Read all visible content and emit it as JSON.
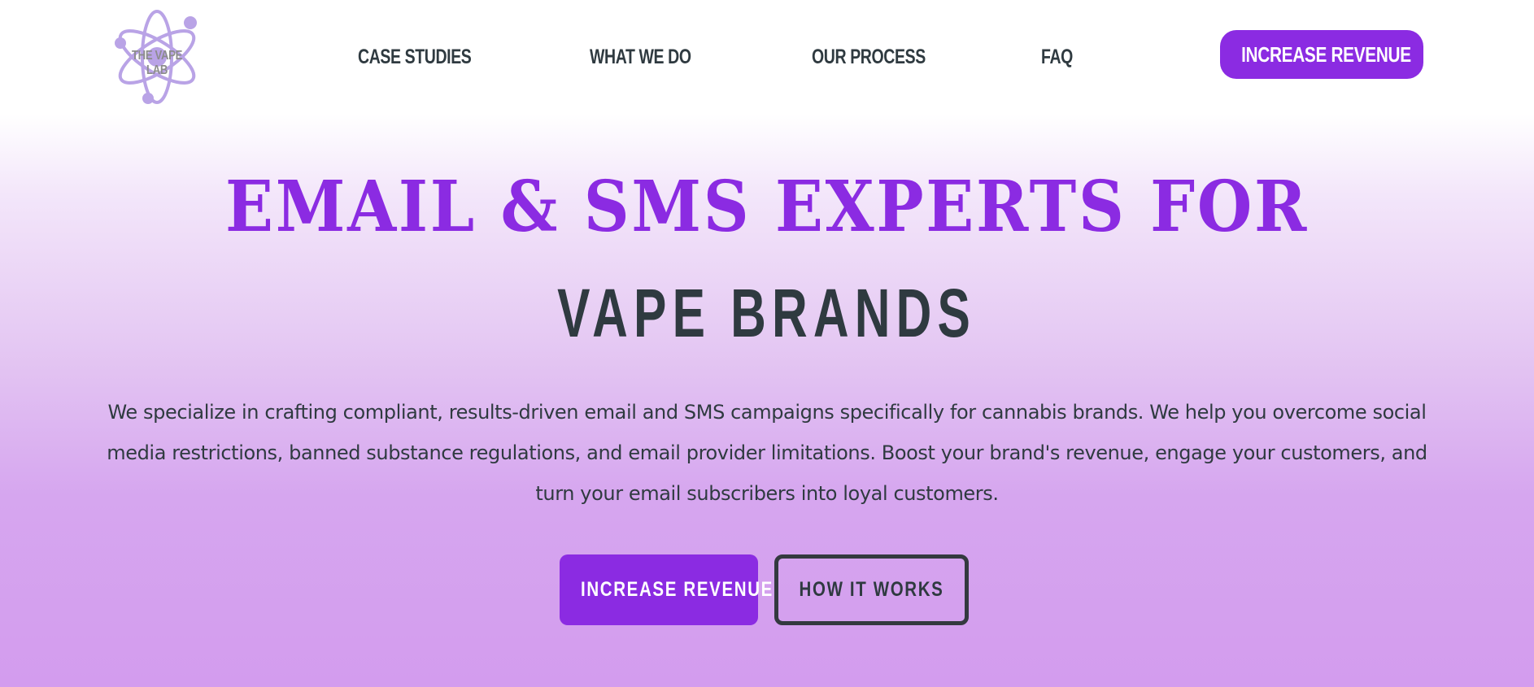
{
  "brand": {
    "logo_text": "THE VAPE LAB",
    "accent_color": "#8b2be2",
    "text_color": "#2f3a40",
    "logo_color": "#b9a3e6"
  },
  "nav": {
    "links": [
      {
        "label": "CASE STUDIES"
      },
      {
        "label": "WHAT WE DO"
      },
      {
        "label": "OUR PROCESS"
      },
      {
        "label": "FAQ"
      }
    ],
    "cta_label": "INCREASE REVENUE"
  },
  "hero": {
    "headline": "EMAIL & SMS EXPERTS FOR",
    "subheadline": "VAPE BRANDS",
    "intro": "We specialize in crafting compliant, results-driven email and SMS campaigns specifically for cannabis brands. We help you overcome social media restrictions, banned substance regulations, and email provider limitations. Boost your brand's revenue, engage your customers, and turn your email subscribers into loyal customers.",
    "primary_button": "INCREASE REVENUE",
    "secondary_button": "HOW IT WORKS"
  }
}
